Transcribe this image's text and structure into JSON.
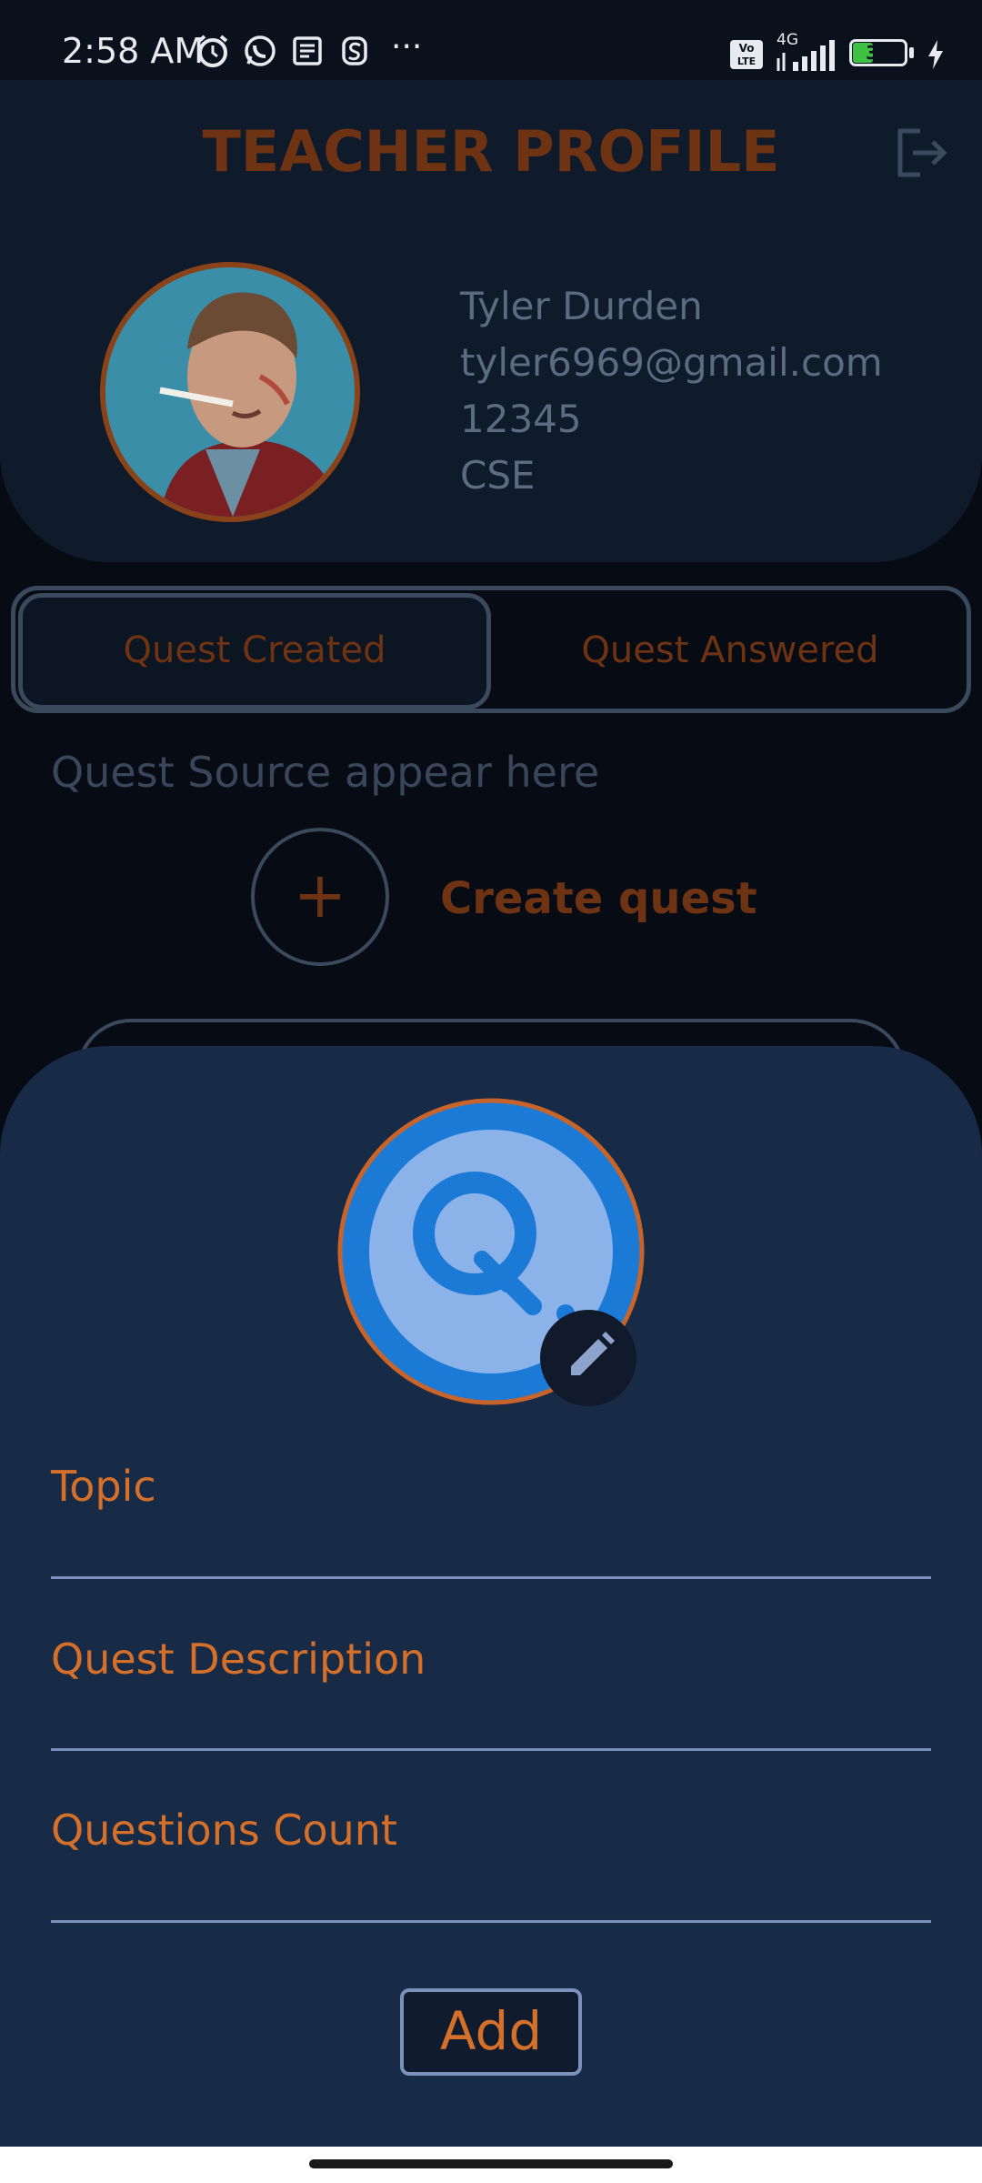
{
  "status_bar": {
    "time": "2:58 AM",
    "overflow": "···",
    "network": "4G",
    "volte": "Vo LTE",
    "battery": "39"
  },
  "header": {
    "title": "TEACHER PROFILE"
  },
  "profile": {
    "name": "Tyler Durden",
    "email": "tyler6969@gmail.com",
    "id": "12345",
    "department": "CSE"
  },
  "tabs": [
    {
      "label": "Quest Created"
    },
    {
      "label": "Quest Answered"
    }
  ],
  "main": {
    "empty_text": "Quest Source appear here",
    "plus": "+",
    "create_label": "Create quest"
  },
  "sheet": {
    "fields": [
      {
        "label": "Topic"
      },
      {
        "label": "Quest Description"
      },
      {
        "label": "Questions Count"
      }
    ],
    "add_label": "Add"
  },
  "colors": {
    "accent": "#d4702a",
    "dim_accent": "#6d3313",
    "sheet_bg": "#172a46",
    "page_bg": "#060b14"
  }
}
